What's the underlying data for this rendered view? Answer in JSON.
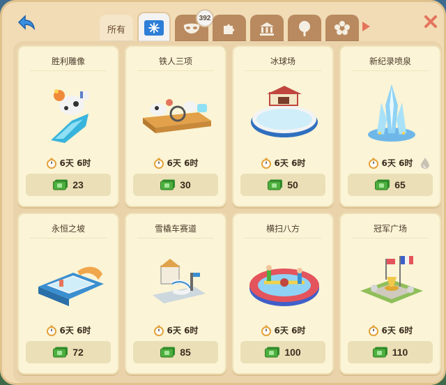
{
  "tabs": [
    {
      "label": "所有",
      "icon": "",
      "active": false
    },
    {
      "label": "",
      "icon": "ice-flag-icon",
      "active": true
    },
    {
      "label": "",
      "icon": "mask-icon",
      "active": false,
      "badge": "392"
    },
    {
      "label": "",
      "icon": "puzzle-icon",
      "active": false
    },
    {
      "label": "",
      "icon": "museum-icon",
      "active": false
    },
    {
      "label": "",
      "icon": "tree-icon",
      "active": false
    },
    {
      "label": "",
      "icon": "flower-icon",
      "active": false
    }
  ],
  "colors": {
    "accent_blue": "#2d7ed6",
    "close_red": "#e4745c",
    "money_green": "#4caf3e",
    "panel": "#f1dcb6"
  },
  "items": [
    {
      "title": "胜利雕像",
      "timer": "6天 6时",
      "price": "23"
    },
    {
      "title": "铁人三项",
      "timer": "6天 6时",
      "price": "30"
    },
    {
      "title": "冰球场",
      "timer": "6天 6时",
      "price": "50"
    },
    {
      "title": "新纪录喷泉",
      "timer": "6天 6时",
      "price": "65"
    },
    {
      "title": "永恒之坡",
      "timer": "6天 6时",
      "price": "72"
    },
    {
      "title": "雪橇车赛道",
      "timer": "6天 6时",
      "price": "85"
    },
    {
      "title": "横扫八方",
      "timer": "6天 6时",
      "price": "100"
    },
    {
      "title": "冠军广场",
      "timer": "6天 6时",
      "price": "110"
    }
  ]
}
